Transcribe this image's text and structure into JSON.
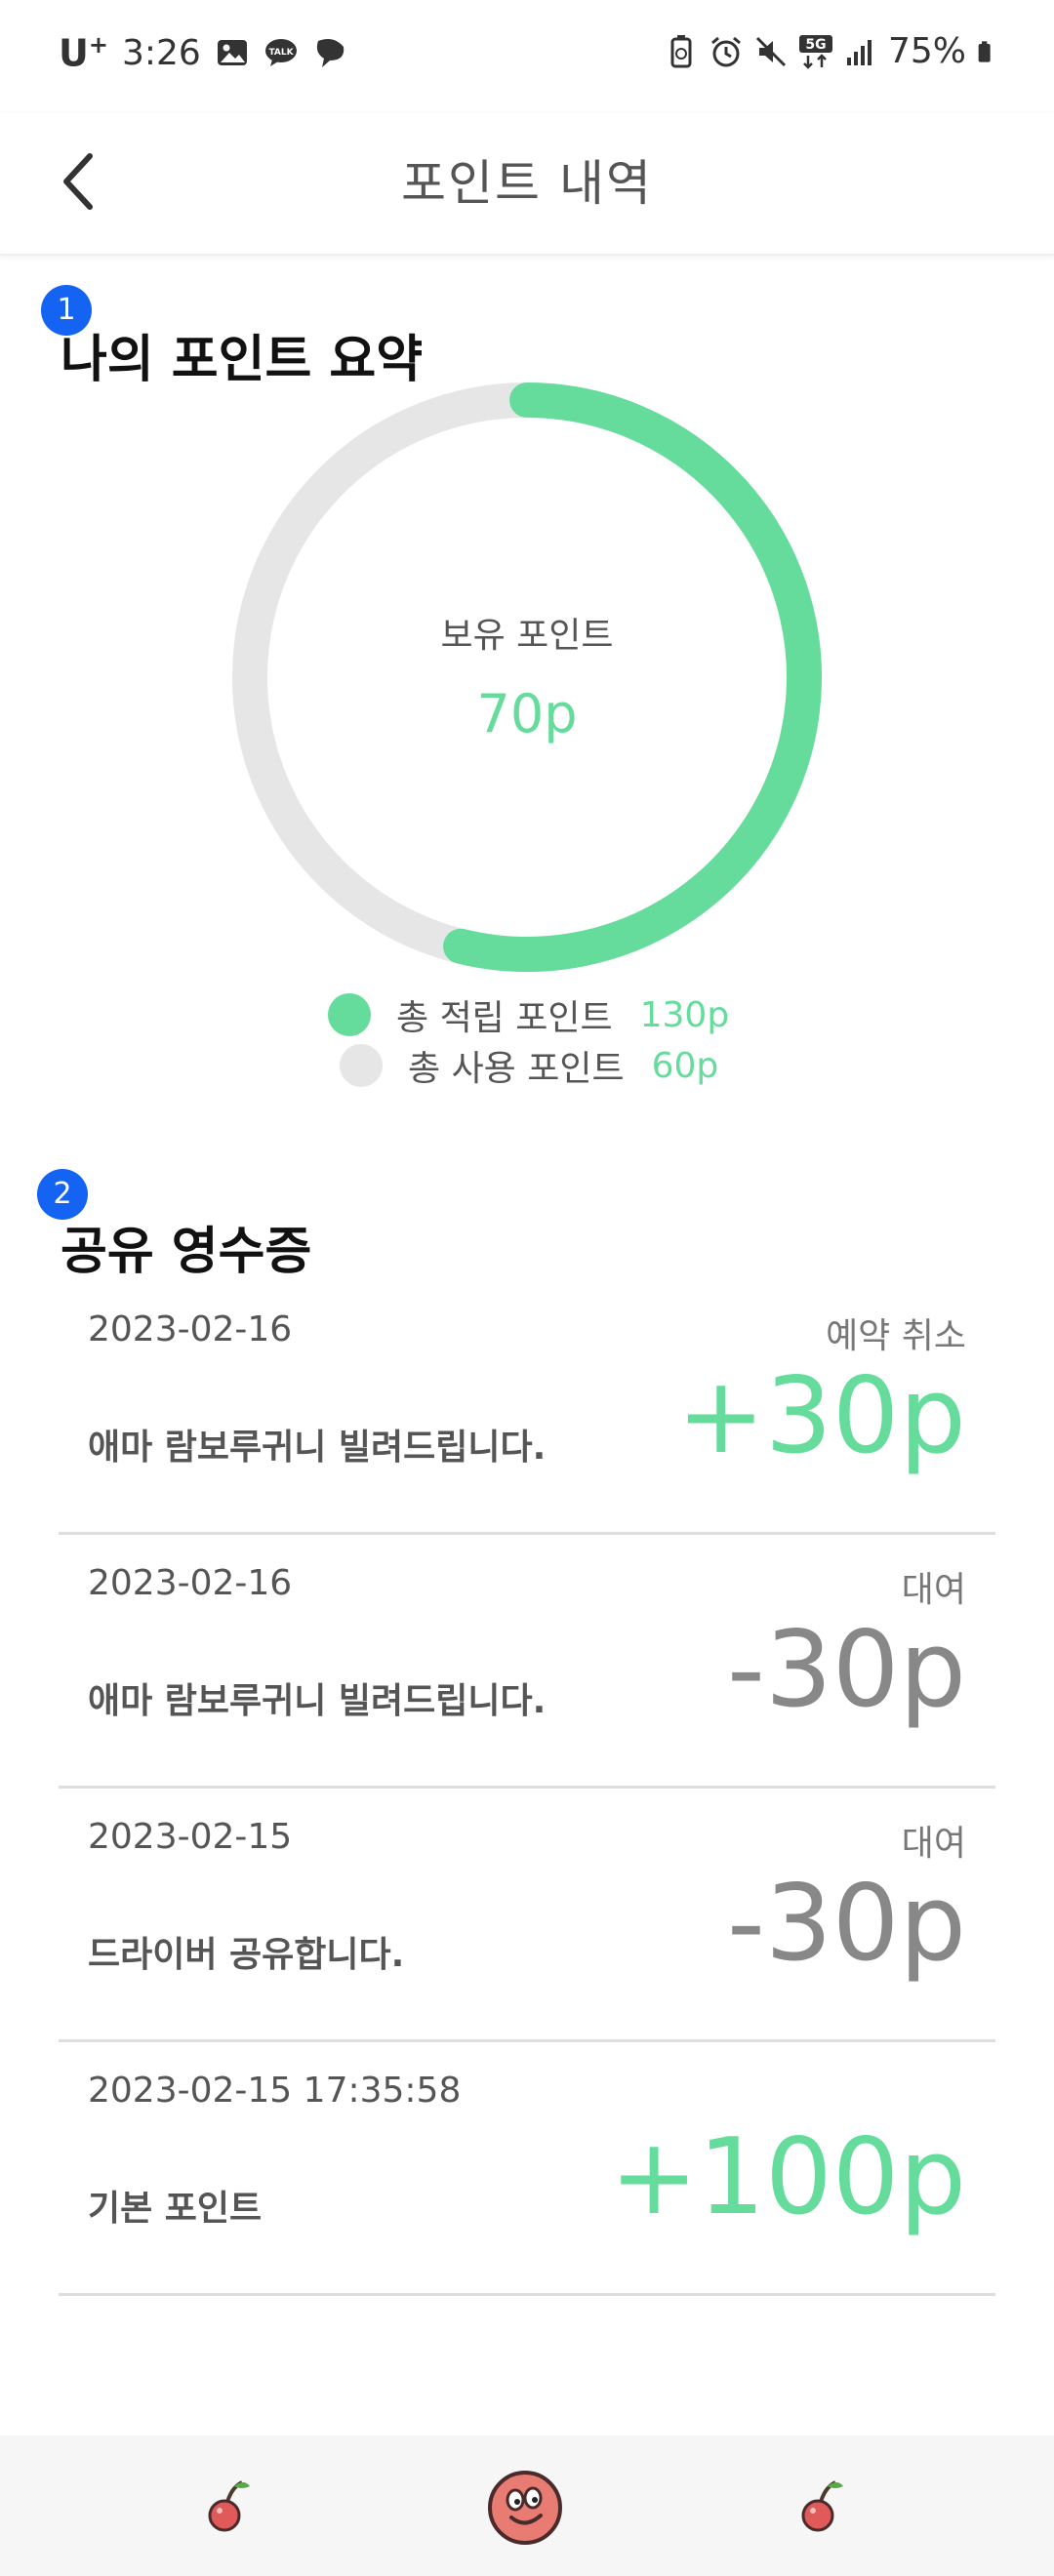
{
  "status_bar": {
    "carrier": "U",
    "carrier_sup": "+",
    "time": "3:26",
    "network": "5G",
    "battery": "75%"
  },
  "header": {
    "title": "포인트 내역"
  },
  "markers": [
    "1",
    "2"
  ],
  "summary": {
    "title": "나의 포인트 요약",
    "balance_label": "보유 포인트",
    "balance_value": "70p",
    "legend": [
      {
        "label": "총 적립 포인트",
        "value": "130p",
        "color": "#66dc9c"
      },
      {
        "label": "총 사용 포인트",
        "value": "60p",
        "color": "#e6e6e6"
      }
    ]
  },
  "chart_data": {
    "type": "pie",
    "donut": true,
    "center_label": "보유 포인트",
    "center_value": "70p",
    "categories": [
      "총 적립 포인트",
      "총 사용 포인트"
    ],
    "values": [
      130,
      60
    ],
    "colors": [
      "#66dc9c",
      "#e6e6e6"
    ]
  },
  "receipts_section": {
    "title": "공유 영수증",
    "items": [
      {
        "date": "2023-02-16",
        "status": "예약 취소",
        "description": "애마 람보루귀니 빌려드립니다.",
        "amount": "+30p",
        "sign": "plus"
      },
      {
        "date": "2023-02-16",
        "status": "대여",
        "description": "애마 람보루귀니 빌려드립니다.",
        "amount": "-30p",
        "sign": "minus"
      },
      {
        "date": "2023-02-15",
        "status": "대여",
        "description": "드라이버 공유합니다.",
        "amount": "-30p",
        "sign": "minus"
      },
      {
        "date": "2023-02-15 17:35:58",
        "status": "",
        "description": "기본 포인트",
        "amount": "+100p",
        "sign": "plus"
      }
    ]
  },
  "colors": {
    "accent": "#66dc9c",
    "marker": "#1463f3",
    "muted": "#888888"
  },
  "bottom_nav": {
    "items": [
      "cherry-icon",
      "character-face-icon",
      "cherry-icon"
    ]
  }
}
